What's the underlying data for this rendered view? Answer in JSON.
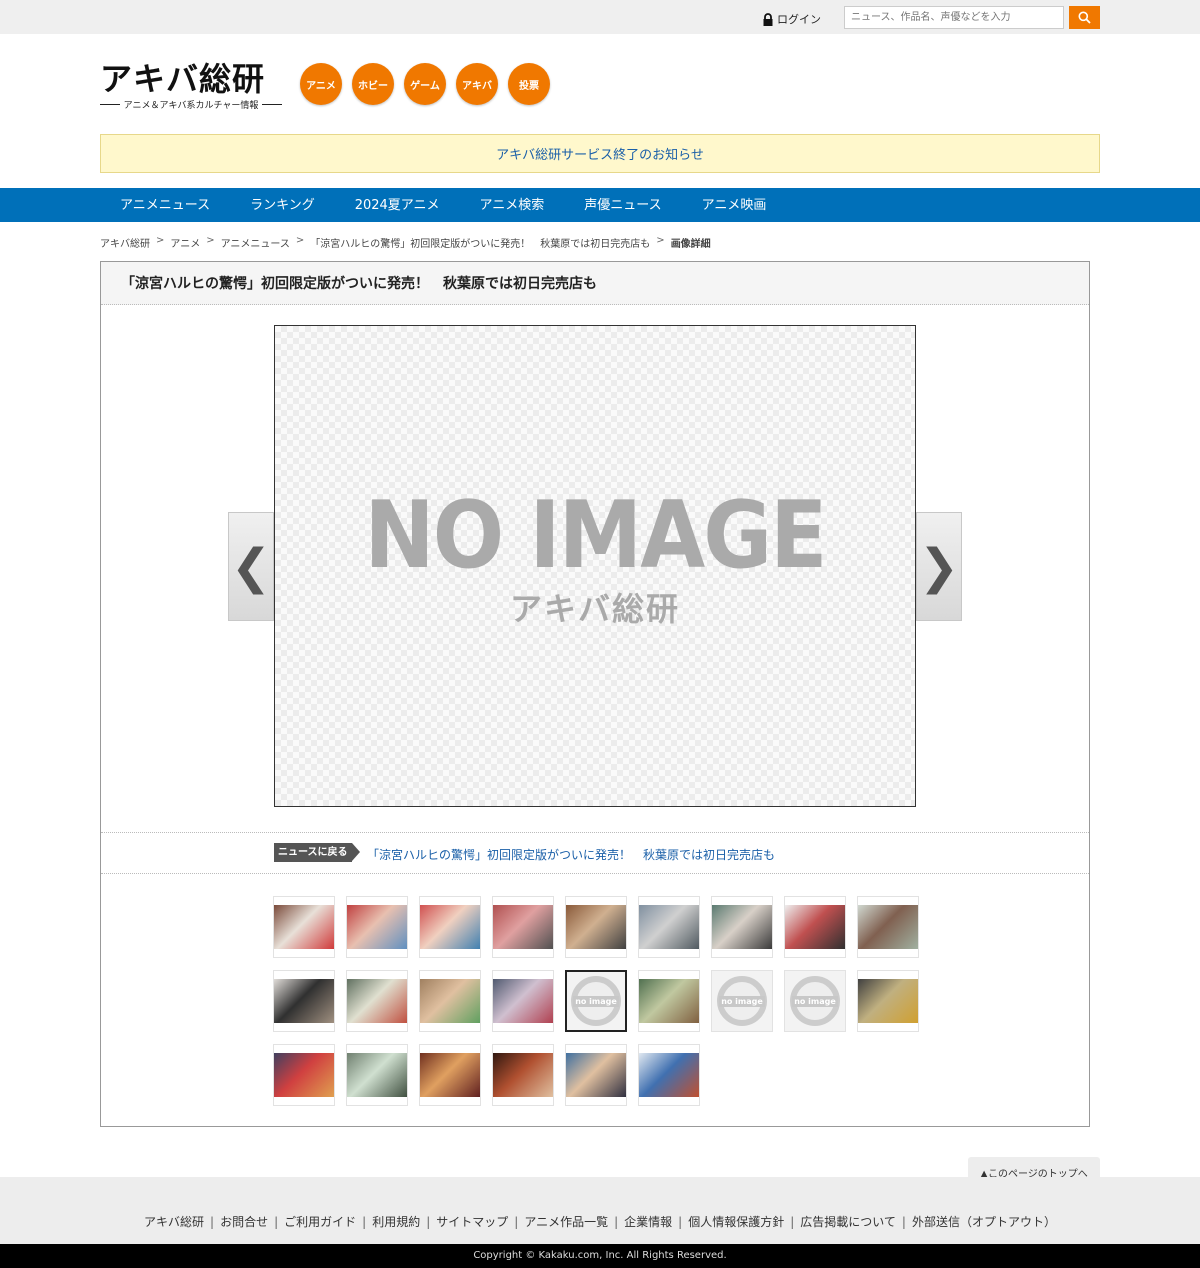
{
  "topbar": {
    "login_label": "ログイン",
    "search_placeholder": "ニュース、作品名、声優などを入力"
  },
  "logo": {
    "main": "アキバ総研",
    "sub": "アニメ＆アキバ系カルチャー情報"
  },
  "circle_nav": [
    "アニメ",
    "ホビー",
    "ゲーム",
    "アキバ",
    "投票"
  ],
  "notice": "アキバ総研サービス終了のお知らせ",
  "main_nav": [
    "アニメニュース",
    "ランキング",
    "2024夏アニメ",
    "アニメ検索",
    "声優ニュース",
    "アニメ映画"
  ],
  "breadcrumb": [
    "アキバ総研",
    "アニメ",
    "アニメニュース",
    "「涼宮ハルヒの驚愕」初回限定版がついに発売！　秋葉原では初日完売店も",
    "画像詳細"
  ],
  "article_title": "「涼宮ハルヒの驚愕」初回限定版がついに発売！　秋葉原では初日完売店も",
  "viewer": {
    "noimage_text": "NO IMAGE",
    "noimage_sub": "アキバ総研",
    "prev": "❮",
    "next": "❯"
  },
  "back": {
    "badge": "ニュースに戻る",
    "link": "「涼宮ハルヒの驚愕」初回限定版がついに発売！　秋葉原では初日完売店も"
  },
  "thumb_noimage_label": "no image",
  "colors": {
    "accent_orange": "#f07800",
    "nav_blue": "#0070b9",
    "notice_bg": "#fff8cc",
    "link_blue": "#1a5fa8"
  },
  "thumbnails": [
    {
      "type": "photo",
      "c1": "#7a4a3a",
      "c2": "#e8e0d8",
      "c3": "#d03a3a"
    },
    {
      "type": "photo",
      "c1": "#c04040",
      "c2": "#e8c0b0",
      "c3": "#6090c0"
    },
    {
      "type": "photo",
      "c1": "#d05050",
      "c2": "#f0d0c0",
      "c3": "#4080b0"
    },
    {
      "type": "photo",
      "c1": "#b05050",
      "c2": "#e0a0a0",
      "c3": "#505050"
    },
    {
      "type": "photo",
      "c1": "#8a5a3a",
      "c2": "#d0b090",
      "c3": "#404040"
    },
    {
      "type": "photo",
      "c1": "#8090a0",
      "c2": "#d0d0d0",
      "c3": "#505a60"
    },
    {
      "type": "photo",
      "c1": "#5a7a70",
      "c2": "#d8d0c8",
      "c3": "#3a3a3a"
    },
    {
      "type": "photo",
      "c1": "#eeeeee",
      "c2": "#c05050",
      "c3": "#303030"
    },
    {
      "type": "photo",
      "c1": "#d0d8d0",
      "c2": "#806050",
      "c3": "#a0b0a0"
    },
    {
      "type": "photo",
      "c1": "#e0dcd8",
      "c2": "#303030",
      "c3": "#a09080"
    },
    {
      "type": "photo",
      "c1": "#607060",
      "c2": "#e0e0d0",
      "c3": "#c05040"
    },
    {
      "type": "photo",
      "c1": "#a08060",
      "c2": "#e0c0a0",
      "c3": "#60a060"
    },
    {
      "type": "photo",
      "c1": "#505a70",
      "c2": "#d0c0d0",
      "c3": "#b04050"
    },
    {
      "type": "noimage",
      "selected": true
    },
    {
      "type": "photo",
      "c1": "#507050",
      "c2": "#c0c8a0",
      "c3": "#806040"
    },
    {
      "type": "noimage"
    },
    {
      "type": "noimage"
    },
    {
      "type": "photo",
      "c1": "#404040",
      "c2": "#c0b080",
      "c3": "#d0a030"
    },
    {
      "type": "photo",
      "c1": "#404060",
      "c2": "#d04040",
      "c3": "#e0a050"
    },
    {
      "type": "photo",
      "c1": "#708070",
      "c2": "#d0e0d0",
      "c3": "#405040"
    },
    {
      "type": "photo",
      "c1": "#703020",
      "c2": "#e0a060",
      "c3": "#602020"
    },
    {
      "type": "photo",
      "c1": "#301810",
      "c2": "#b05030",
      "c3": "#e0c0a0"
    },
    {
      "type": "photo",
      "c1": "#4070a0",
      "c2": "#e0c0a0",
      "c3": "#303040"
    },
    {
      "type": "photo",
      "c1": "#e0e8f0",
      "c2": "#4070b0",
      "c3": "#c05030"
    }
  ],
  "pagetop": "▲このページのトップへ",
  "footer_links": [
    "アキバ総研",
    "お問合せ",
    "ご利用ガイド",
    "利用規約",
    "サイトマップ",
    "アニメ作品一覧",
    "企業情報",
    "個人情報保護方針",
    "広告掲載について",
    "外部送信（オプトアウト）"
  ],
  "copyright": "Copyright © Kakaku.com, Inc. All Rights Reserved."
}
